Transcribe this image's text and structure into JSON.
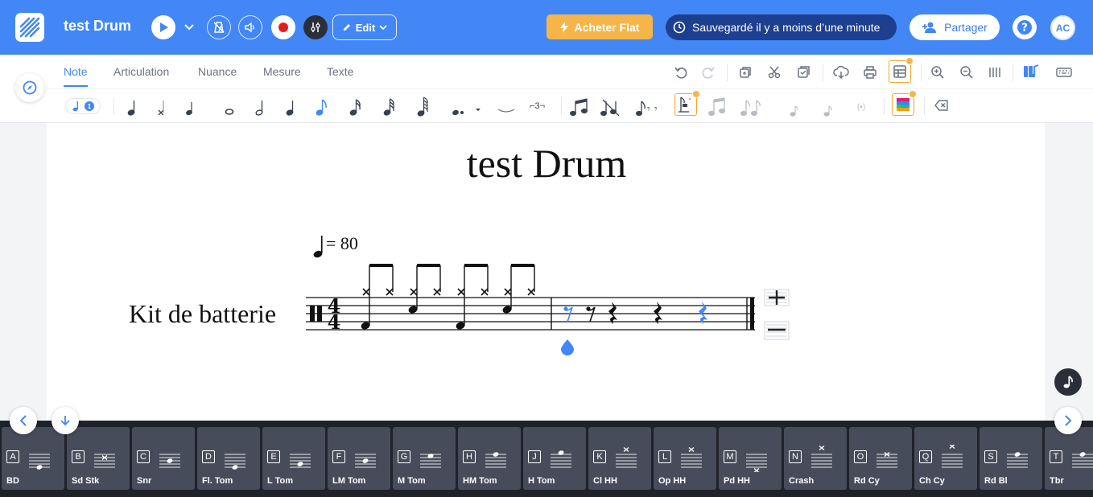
{
  "header": {
    "title": "test Drum",
    "edit_label": "Edit",
    "buy_label": "Acheter Flat",
    "saved_label": "Sauvegardé il y a moins d’une minute",
    "share_label": "Partager",
    "avatar_initials": "AC",
    "accent": "#4287f5"
  },
  "toolbar": {
    "tabs": [
      "Note",
      "Articulation",
      "Nuance",
      "Mesure",
      "Texte"
    ],
    "active_tab": "Note",
    "voice_badge": "1",
    "tuplet_label": "3"
  },
  "score": {
    "title": "test Drum",
    "tempo": "= 80",
    "instrument": "Kit de batterie",
    "time_signature_top": "4",
    "time_signature_bottom": "4"
  },
  "keyboard": {
    "keys": [
      {
        "letter": "A",
        "name": "BD"
      },
      {
        "letter": "B",
        "name": "Sd Stk"
      },
      {
        "letter": "C",
        "name": "Snr"
      },
      {
        "letter": "D",
        "name": "Fl. Tom"
      },
      {
        "letter": "E",
        "name": "L Tom"
      },
      {
        "letter": "F",
        "name": "LM Tom"
      },
      {
        "letter": "G",
        "name": "M Tom"
      },
      {
        "letter": "H",
        "name": "HM Tom"
      },
      {
        "letter": "J",
        "name": "H Tom"
      },
      {
        "letter": "K",
        "name": "Cl HH"
      },
      {
        "letter": "L",
        "name": "Op HH"
      },
      {
        "letter": "M",
        "name": "Pd HH"
      },
      {
        "letter": "N",
        "name": "Crash"
      },
      {
        "letter": "O",
        "name": "Rd Cy"
      },
      {
        "letter": "Q",
        "name": "Ch Cy"
      },
      {
        "letter": "S",
        "name": "Rd Bl"
      },
      {
        "letter": "T",
        "name": "Tbr"
      }
    ]
  }
}
